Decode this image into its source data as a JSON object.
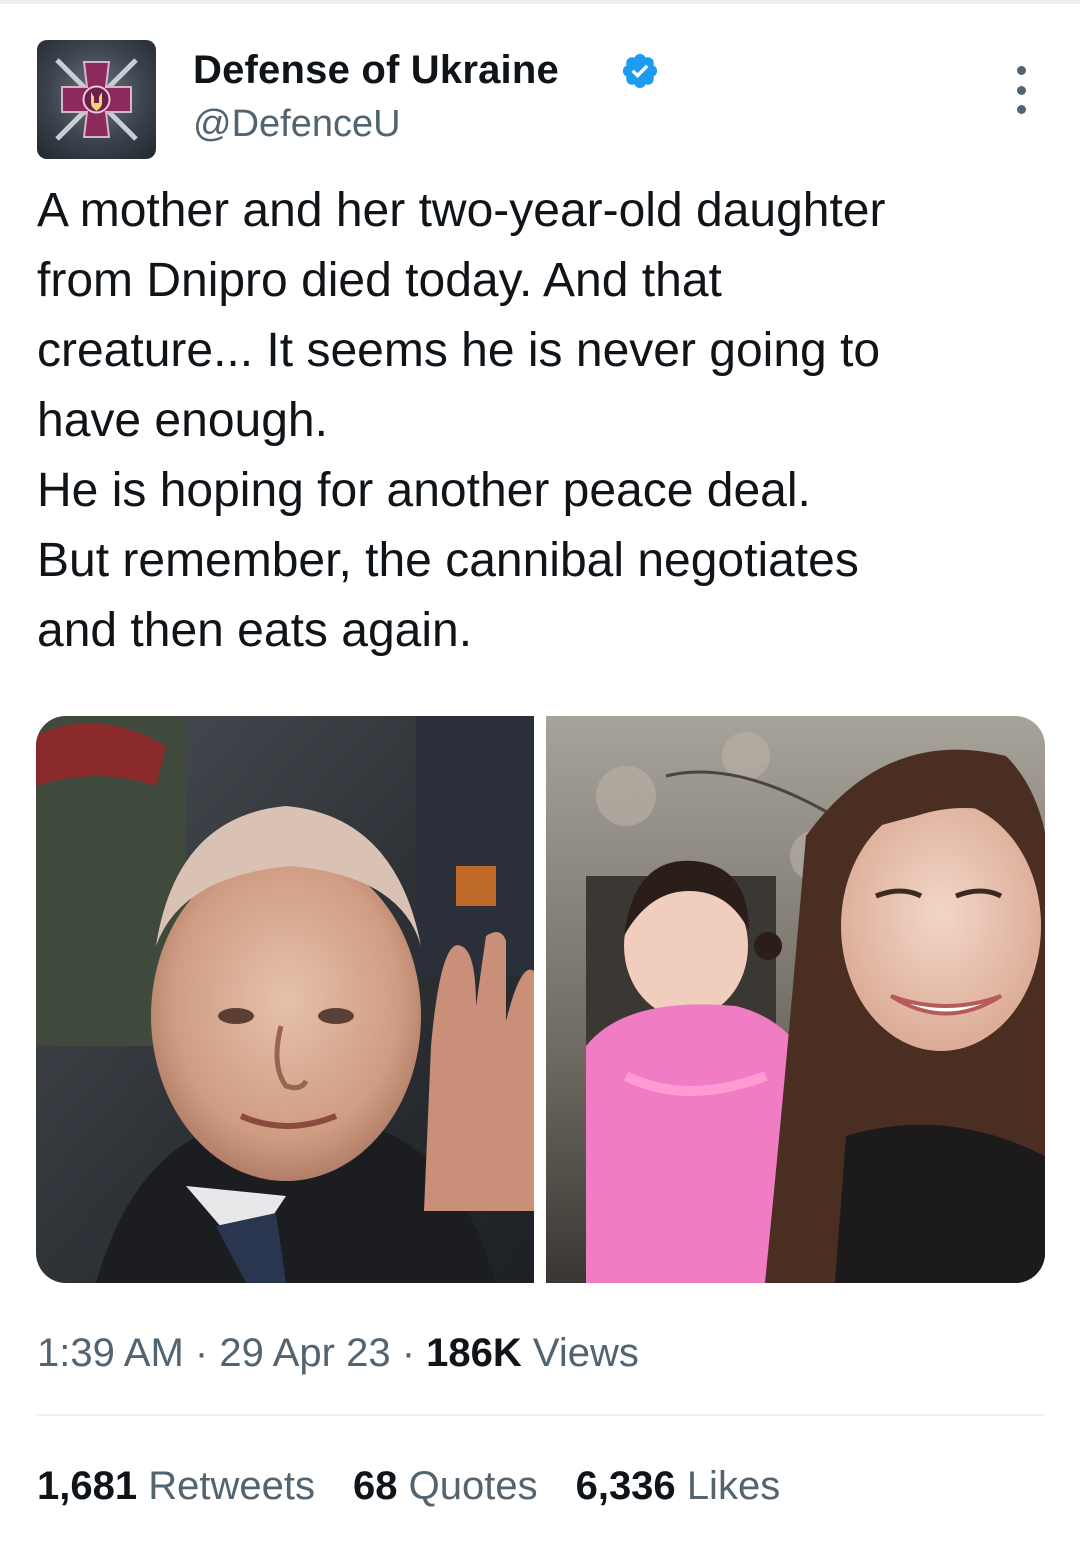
{
  "author": {
    "display_name": "Defense of Ukraine",
    "handle": "@DefenceU",
    "verified": true,
    "avatar_icon": "ukraine-defense-emblem-icon"
  },
  "tweet": {
    "text_lines": [
      "A mother and her two-year-old daughter",
      "from Dnipro died today. And that",
      "creature... It seems he is never going to",
      "have enough.",
      "He is hoping for another peace deal.",
      "But remember, the cannibal negotiates",
      "and then eats again."
    ],
    "media": [
      {
        "icon": "photo-man-waving"
      },
      {
        "icon": "photo-mother-and-daughter"
      }
    ]
  },
  "meta": {
    "time": "1:39 AM",
    "separator": "·",
    "date": "29 Apr 23",
    "views_count": "186K",
    "views_label": "Views"
  },
  "stats": {
    "retweets_count": "1,681",
    "retweets_label": "Retweets",
    "quotes_count": "68",
    "quotes_label": "Quotes",
    "likes_count": "6,336",
    "likes_label": "Likes"
  },
  "colors": {
    "text_primary": "#0f1419",
    "text_secondary": "#536471",
    "verified_blue": "#1d9bf0",
    "divider": "#eff3f4"
  }
}
